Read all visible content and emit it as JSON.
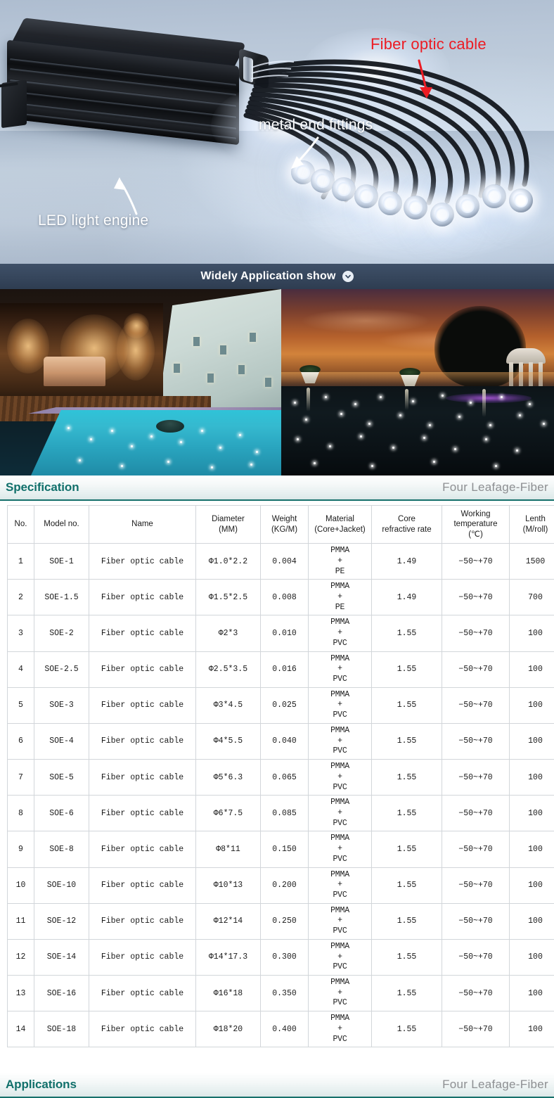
{
  "hero": {
    "labels": [
      {
        "text": "LED light engine",
        "color": "#ffffff"
      },
      {
        "text": "metal end fittings",
        "color": "#ffffff"
      },
      {
        "text": "Fiber optic cable",
        "color": "#ec1c24"
      }
    ],
    "label_led": "LED light engine",
    "label_fittings": "metal end fittings",
    "label_fiber": "Fiber optic cable"
  },
  "app_bar": {
    "title": "Widely Application show",
    "icon": "chevron-down-circle-icon"
  },
  "photos": [
    {
      "caption": "villa terrace pool at night with warm interior lighting"
    },
    {
      "caption": "infinity pool with fiber optic star lights at sunset"
    }
  ],
  "spec_section": {
    "title": "Specification",
    "brand": "Four  Leafage-Fiber",
    "accent_color": "#11706b",
    "brand_color": "#8d8f92"
  },
  "applications_section": {
    "title": "Applications",
    "brand": "Four  Leafage-Fiber"
  },
  "table": {
    "columns": [
      "No.",
      "Model no.",
      "Name",
      "Diameter\n(MM)",
      "Weight\n(KG/M)",
      "Material\n(Core+Jacket)",
      "Core\nrefractive rate",
      "Working\ntemperature\n(℃)",
      "Lenth\n(M/roll)"
    ],
    "columns_split": [
      {
        "l1": "No.",
        "l2": "",
        "l3": ""
      },
      {
        "l1": "Model no.",
        "l2": "",
        "l3": ""
      },
      {
        "l1": "Name",
        "l2": "",
        "l3": ""
      },
      {
        "l1": "Diameter",
        "l2": "(MM)",
        "l3": ""
      },
      {
        "l1": "Weight",
        "l2": "(KG/M)",
        "l3": ""
      },
      {
        "l1": "Material",
        "l2": "(Core+Jacket)",
        "l3": ""
      },
      {
        "l1": "Core",
        "l2": "refractive rate",
        "l3": ""
      },
      {
        "l1": "Working",
        "l2": "temperature",
        "l3": "(℃)"
      },
      {
        "l1": "Lenth",
        "l2": "(M/roll)",
        "l3": ""
      }
    ],
    "rows": [
      {
        "no": "1",
        "model": "SOE-1",
        "name": "Fiber optic cable",
        "diameter": "Φ1.0*2.2",
        "weight": "0.004",
        "core": "PMMA",
        "plus": "+",
        "jacket": "PE",
        "refractive": "1.49",
        "temp": "−50~+70",
        "length": "1500"
      },
      {
        "no": "2",
        "model": "SOE-1.5",
        "name": "Fiber optic cable",
        "diameter": "Φ1.5*2.5",
        "weight": "0.008",
        "core": "PMMA",
        "plus": "+",
        "jacket": "PE",
        "refractive": "1.49",
        "temp": "−50~+70",
        "length": "700"
      },
      {
        "no": "3",
        "model": "SOE-2",
        "name": "Fiber optic cable",
        "diameter": "Φ2*3",
        "weight": "0.010",
        "core": "PMMA",
        "plus": "+",
        "jacket": "PVC",
        "refractive": "1.55",
        "temp": "−50~+70",
        "length": "100"
      },
      {
        "no": "4",
        "model": "SOE-2.5",
        "name": "Fiber optic cable",
        "diameter": "Φ2.5*3.5",
        "weight": "0.016",
        "core": "PMMA",
        "plus": "+",
        "jacket": "PVC",
        "refractive": "1.55",
        "temp": "−50~+70",
        "length": "100"
      },
      {
        "no": "5",
        "model": "SOE-3",
        "name": "Fiber optic cable",
        "diameter": "Φ3*4.5",
        "weight": "0.025",
        "core": "PMMA",
        "plus": "+",
        "jacket": "PVC",
        "refractive": "1.55",
        "temp": "−50~+70",
        "length": "100"
      },
      {
        "no": "6",
        "model": "SOE-4",
        "name": "Fiber optic cable",
        "diameter": "Φ4*5.5",
        "weight": "0.040",
        "core": "PMMA",
        "plus": "+",
        "jacket": "PVC",
        "refractive": "1.55",
        "temp": "−50~+70",
        "length": "100"
      },
      {
        "no": "7",
        "model": "SOE-5",
        "name": "Fiber optic cable",
        "diameter": "Φ5*6.3",
        "weight": "0.065",
        "core": "PMMA",
        "plus": "+",
        "jacket": "PVC",
        "refractive": "1.55",
        "temp": "−50~+70",
        "length": "100"
      },
      {
        "no": "8",
        "model": "SOE-6",
        "name": "Fiber optic cable",
        "diameter": "Φ6*7.5",
        "weight": "0.085",
        "core": "PMMA",
        "plus": "+",
        "jacket": "PVC",
        "refractive": "1.55",
        "temp": "−50~+70",
        "length": "100"
      },
      {
        "no": "9",
        "model": "SOE-8",
        "name": "Fiber optic cable",
        "diameter": "Φ8*11",
        "weight": "0.150",
        "core": "PMMA",
        "plus": "+",
        "jacket": "PVC",
        "refractive": "1.55",
        "temp": "−50~+70",
        "length": "100"
      },
      {
        "no": "10",
        "model": "SOE-10",
        "name": "Fiber optic cable",
        "diameter": "Φ10*13",
        "weight": "0.200",
        "core": "PMMA",
        "plus": "+",
        "jacket": "PVC",
        "refractive": "1.55",
        "temp": "−50~+70",
        "length": "100"
      },
      {
        "no": "11",
        "model": "SOE-12",
        "name": "Fiber optic cable",
        "diameter": "Φ12*14",
        "weight": "0.250",
        "core": "PMMA",
        "plus": "+",
        "jacket": "PVC",
        "refractive": "1.55",
        "temp": "−50~+70",
        "length": "100"
      },
      {
        "no": "12",
        "model": "SOE-14",
        "name": "Fiber optic cable",
        "diameter": "Φ14*17.3",
        "weight": "0.300",
        "core": "PMMA",
        "plus": "+",
        "jacket": "PVC",
        "refractive": "1.55",
        "temp": "−50~+70",
        "length": "100"
      },
      {
        "no": "13",
        "model": "SOE-16",
        "name": "Fiber optic cable",
        "diameter": "Φ16*18",
        "weight": "0.350",
        "core": "PMMA",
        "plus": "+",
        "jacket": "PVC",
        "refractive": "1.55",
        "temp": "−50~+70",
        "length": "100"
      },
      {
        "no": "14",
        "model": "SOE-18",
        "name": "Fiber optic cable",
        "diameter": "Φ18*20",
        "weight": "0.400",
        "core": "PMMA",
        "plus": "+",
        "jacket": "PVC",
        "refractive": "1.55",
        "temp": "−50~+70",
        "length": "100"
      }
    ]
  }
}
